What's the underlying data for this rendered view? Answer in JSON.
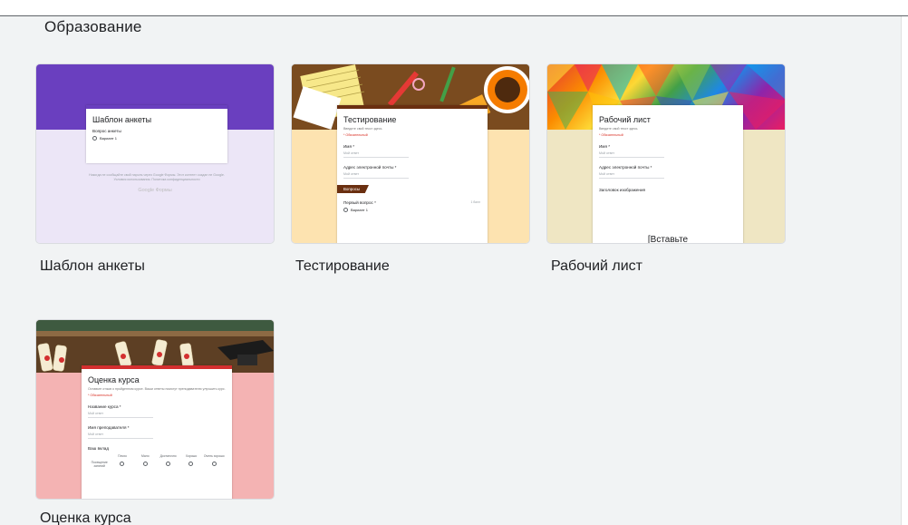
{
  "section": {
    "title": "Образование"
  },
  "cards": [
    {
      "label": "Шаблон анкеты",
      "preview": {
        "title": "Шаблон анкеты",
        "question": "Вопрос анкеты",
        "option": "Вариант 1",
        "footer": "Никогда не сообщайте свой пароль через Google Формы. Этот контент создан не Google. Условия использования. Политика конфиденциальности",
        "brand": "Google Формы"
      },
      "colors": {
        "header": "#6a3fbf",
        "background": "#ece6f7"
      }
    },
    {
      "label": "Тестирование",
      "preview": {
        "title": "Тестирование",
        "description": "Введите свой текст здесь",
        "required": "* Обязательный",
        "name_q": "Имя *",
        "name_a": "Мой ответ",
        "email_q": "Адрес электронной почты *",
        "email_a": "Мой ответ",
        "section": "Вопросы",
        "first_q": "Первый вопрос *",
        "points": "1 балл",
        "option": "Вариант 1"
      },
      "colors": {
        "header": "#7a4b1f",
        "background": "#fde3b0"
      }
    },
    {
      "label": "Рабочий лист",
      "preview": {
        "title": "Рабочий лист",
        "description": "Введите свой текст здесь",
        "required": "* Обязательный",
        "name_q": "Имя *",
        "name_a": "Мой ответ",
        "email_q": "Адрес электронной почты *",
        "email_a": "Мой ответ",
        "image_title": "Заголовок изображения",
        "insert": "[Вставьте"
      },
      "colors": {
        "background": "#efe6c3"
      }
    },
    {
      "label": "Оценка курса",
      "preview": {
        "title": "Оценка курса",
        "description": "Оставьте отзыв о пройденном курсе. Ваши ответы помогут преподавателю улучшить курс.",
        "required": "* Обязательный",
        "course_q": "Название курса *",
        "course_a": "Мой ответ",
        "teacher_q": "Имя преподавателя *",
        "teacher_a": "Мой ответ",
        "grid_title": "Ваш вклад",
        "columns": [
          "Плохо",
          "Мало",
          "Достаточно",
          "Хорошо",
          "Очень хорошо"
        ],
        "row": "Посещение занятий"
      },
      "colors": {
        "header": "#6b4a2c",
        "background": "#f4b3b3"
      }
    }
  ]
}
